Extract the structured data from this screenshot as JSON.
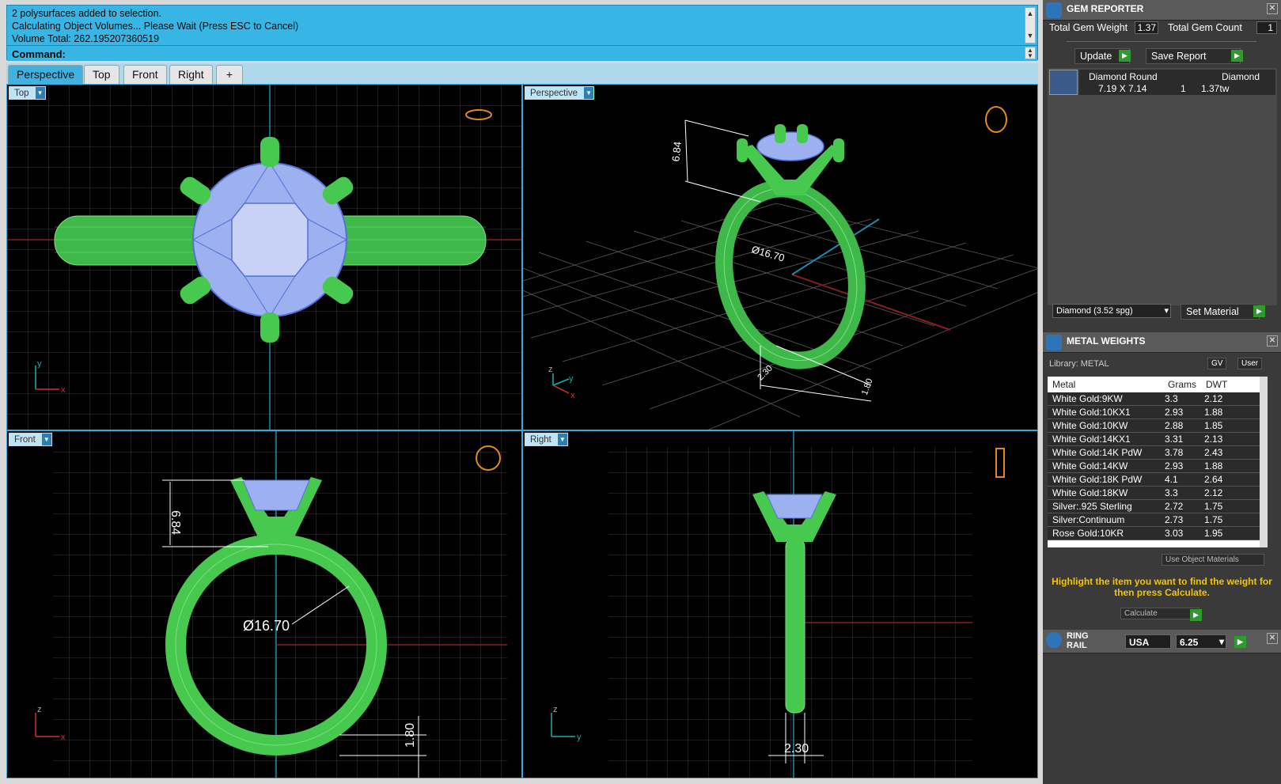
{
  "command": {
    "history": [
      "2 polysurfaces added to selection.",
      "Calculating Object Volumes... Please Wait (Press ESC to Cancel)",
      "Volume Total: 262.195207360519"
    ],
    "prompt_label": "Command:"
  },
  "tabs": [
    "Perspective",
    "Top",
    "Front",
    "Right"
  ],
  "tab_add": "+",
  "viewports": {
    "top": {
      "label": "Top",
      "axis_x": "x",
      "axis_y": "y"
    },
    "perspective": {
      "label": "Perspective",
      "dim_height": "6.84",
      "dim_diameter": "Ø16.70",
      "dim_bottom1": "2.30",
      "dim_bottom2": "1.80",
      "axis_x": "x",
      "axis_y": "y",
      "axis_z": "z"
    },
    "front": {
      "label": "Front",
      "dim_height": "6.84",
      "dim_diameter": "Ø16.70",
      "dim_band": "1.80",
      "axis_x": "x",
      "axis_z": "z"
    },
    "right": {
      "label": "Right",
      "dim_width": "2.30",
      "axis_y": "y",
      "axis_z": "z"
    }
  },
  "gem_reporter": {
    "title": "GEM REPORTER",
    "total_weight_label": "Total Gem Weight",
    "total_weight_value": "1.37",
    "total_count_label": "Total Gem Count",
    "total_count_value": "1",
    "update_label": "Update",
    "save_report_label": "Save Report",
    "gem": {
      "shape": "Diamond Round",
      "size": "7.19 X 7.14",
      "type": "Diamond",
      "count": "1",
      "tw": "1.37tw"
    },
    "material_select": "Diamond    (3.52 spg)",
    "set_material_label": "Set Material"
  },
  "metal_weights": {
    "title": "METAL WEIGHTS",
    "library_label": "Library: METAL",
    "gv_label": "GV",
    "user_label": "User",
    "columns": [
      "Metal",
      "Grams",
      "DWT"
    ],
    "rows": [
      [
        "White Gold:9KW",
        "3.3",
        "2.12"
      ],
      [
        "White Gold:10KX1",
        "2.93",
        "1.88"
      ],
      [
        "White Gold:10KW",
        "2.88",
        "1.85"
      ],
      [
        "White Gold:14KX1",
        "3.31",
        "2.13"
      ],
      [
        "White Gold:14K PdW",
        "3.78",
        "2.43"
      ],
      [
        "White Gold:14KW",
        "2.93",
        "1.88"
      ],
      [
        "White Gold:18K PdW",
        "4.1",
        "2.64"
      ],
      [
        "White Gold:18KW",
        "3.3",
        "2.12"
      ],
      [
        "Silver:.925 Sterling",
        "2.72",
        "1.75"
      ],
      [
        "Silver:Continuum",
        "2.73",
        "1.75"
      ],
      [
        "Rose Gold:10KR",
        "3.03",
        "1.95"
      ]
    ],
    "use_object_materials": "Use Object Materials",
    "hint": "Highlight the item you want to find the weight for then press Calculate.",
    "calculate_label": "Calculate"
  },
  "ring_rail": {
    "title_line1": "RING",
    "title_line2": "RAIL",
    "region": "USA",
    "size": "6.25"
  }
}
